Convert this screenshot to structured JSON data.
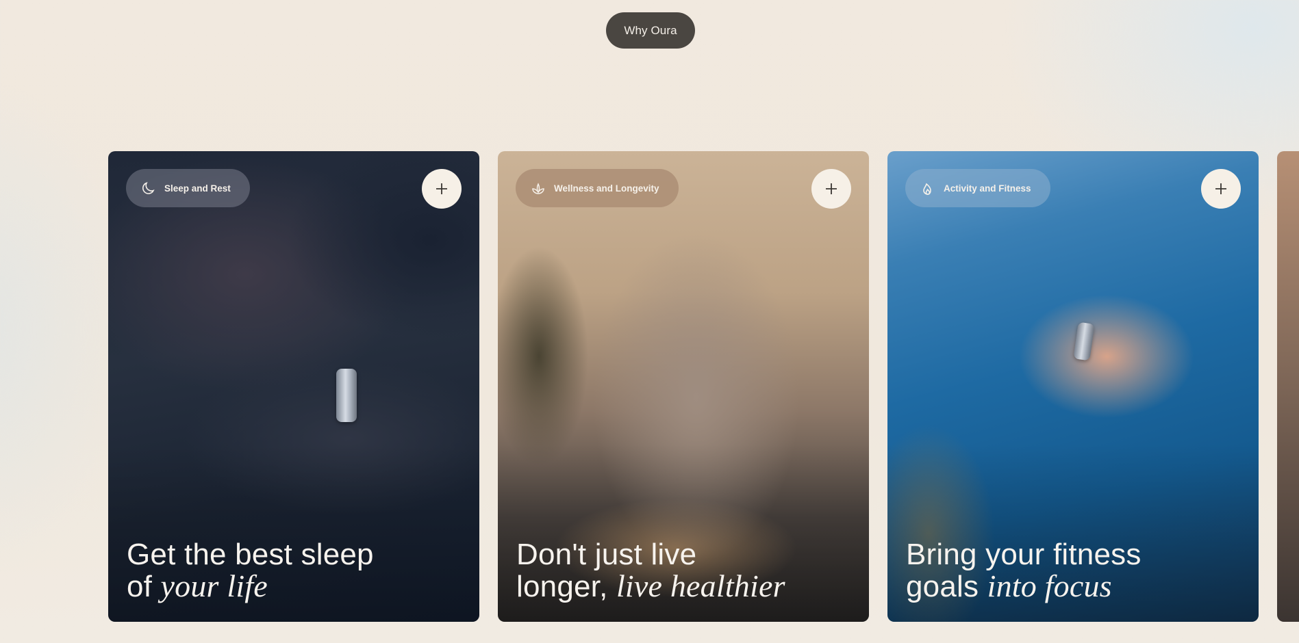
{
  "header": {
    "why_label": "Why Oura"
  },
  "cards": [
    {
      "tag": "Sleep and Rest",
      "icon": "moon-icon",
      "line1": "Get the best sleep",
      "line2_plain": "of ",
      "line2_italic": "your life"
    },
    {
      "tag": "Wellness and Longevity",
      "icon": "lotus-icon",
      "line1": "Don't just live",
      "line2_plain": "longer, ",
      "line2_italic": "live healthier"
    },
    {
      "tag": "Activity and Fitness",
      "icon": "flame-icon",
      "line1": "Bring your fitness",
      "line2_plain": "goals ",
      "line2_italic": "into focus"
    }
  ],
  "colors": {
    "pill_bg": "#4a4641",
    "plus_bg": "#f6f0e7",
    "headline_text": "#f7f3ee"
  }
}
